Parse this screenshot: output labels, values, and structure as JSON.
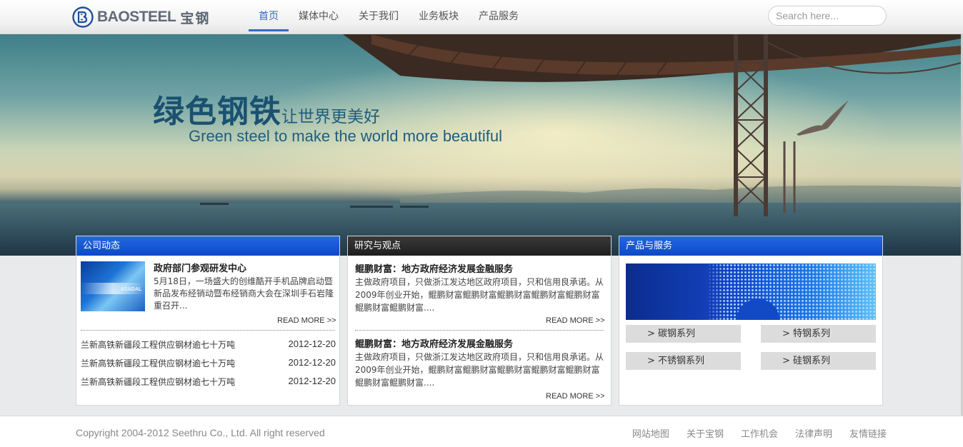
{
  "header": {
    "logo_text": "BAOSTEEL",
    "logo_cn": "宝钢",
    "nav": [
      {
        "label": "首页",
        "active": true
      },
      {
        "label": "媒体中心",
        "active": false
      },
      {
        "label": "关于我们",
        "active": false
      },
      {
        "label": "业务板块",
        "active": false
      },
      {
        "label": "产品服务",
        "active": false
      }
    ],
    "search_placeholder": "Search here..."
  },
  "banner": {
    "title_big": "绿色钢铁",
    "title_small": "让世界更美好",
    "subtitle": "Green steel to make the world more beautiful"
  },
  "company_news": {
    "heading": "公司动态",
    "thumb_label": "ASADAL",
    "featured": {
      "title": "政府部门参观研发中心",
      "body": "5月18日，一场盛大的创维酷开手机品牌启动暨新品发布经销动暨布经销商大会在深圳手石岩隆重召开...",
      "more": "READ MORE >>"
    },
    "items": [
      {
        "title": "兰新高铁新疆段工程供应钢材逾七十万吨",
        "date": "2012-12-20"
      },
      {
        "title": "兰新高铁新疆段工程供应钢材逾七十万吨",
        "date": "2012-12-20"
      },
      {
        "title": "兰新高铁新疆段工程供应钢材逾七十万吨",
        "date": "2012-12-20"
      }
    ]
  },
  "research": {
    "heading": "研究与观点",
    "articles": [
      {
        "title": "鲲鹏财富：地方政府经济发展金融服务",
        "body": "主做政府项目，只做浙江发达地区政府项目，只和信用良承诺。从2009年创业开始，鲲鹏财富鲲鹏财富鲲鹏财富鲲鹏财富鲲鹏财富鲲鹏财富鲲鹏财富....",
        "more": "READ MORE >>"
      },
      {
        "title": "鲲鹏财富：地方政府经济发展金融服务",
        "body": "主做政府项目，只做浙江发达地区政府项目，只和信用良承诺。从2009年创业开始，鲲鹏财富鲲鹏财富鲲鹏财富鲲鹏财富鲲鹏财富鲲鹏财富鲲鹏财富....",
        "more": "READ MORE >>"
      }
    ]
  },
  "products": {
    "heading": "产品与服务",
    "buttons": [
      "> 碳钢系列",
      "> 特钢系列",
      "> 不锈钢系列",
      "> 硅钢系列"
    ]
  },
  "footer": {
    "copyright": "Copyright 2004-2012 Seethru Co., Ltd. All right reserved",
    "links": [
      "网站地图",
      "关于宝钢",
      "工作机会",
      "法律声明",
      "友情链接"
    ]
  },
  "colors": {
    "accent_blue": "#0b49c5",
    "nav_active": "#3468c4",
    "dark_header": "#1e1e1e"
  }
}
